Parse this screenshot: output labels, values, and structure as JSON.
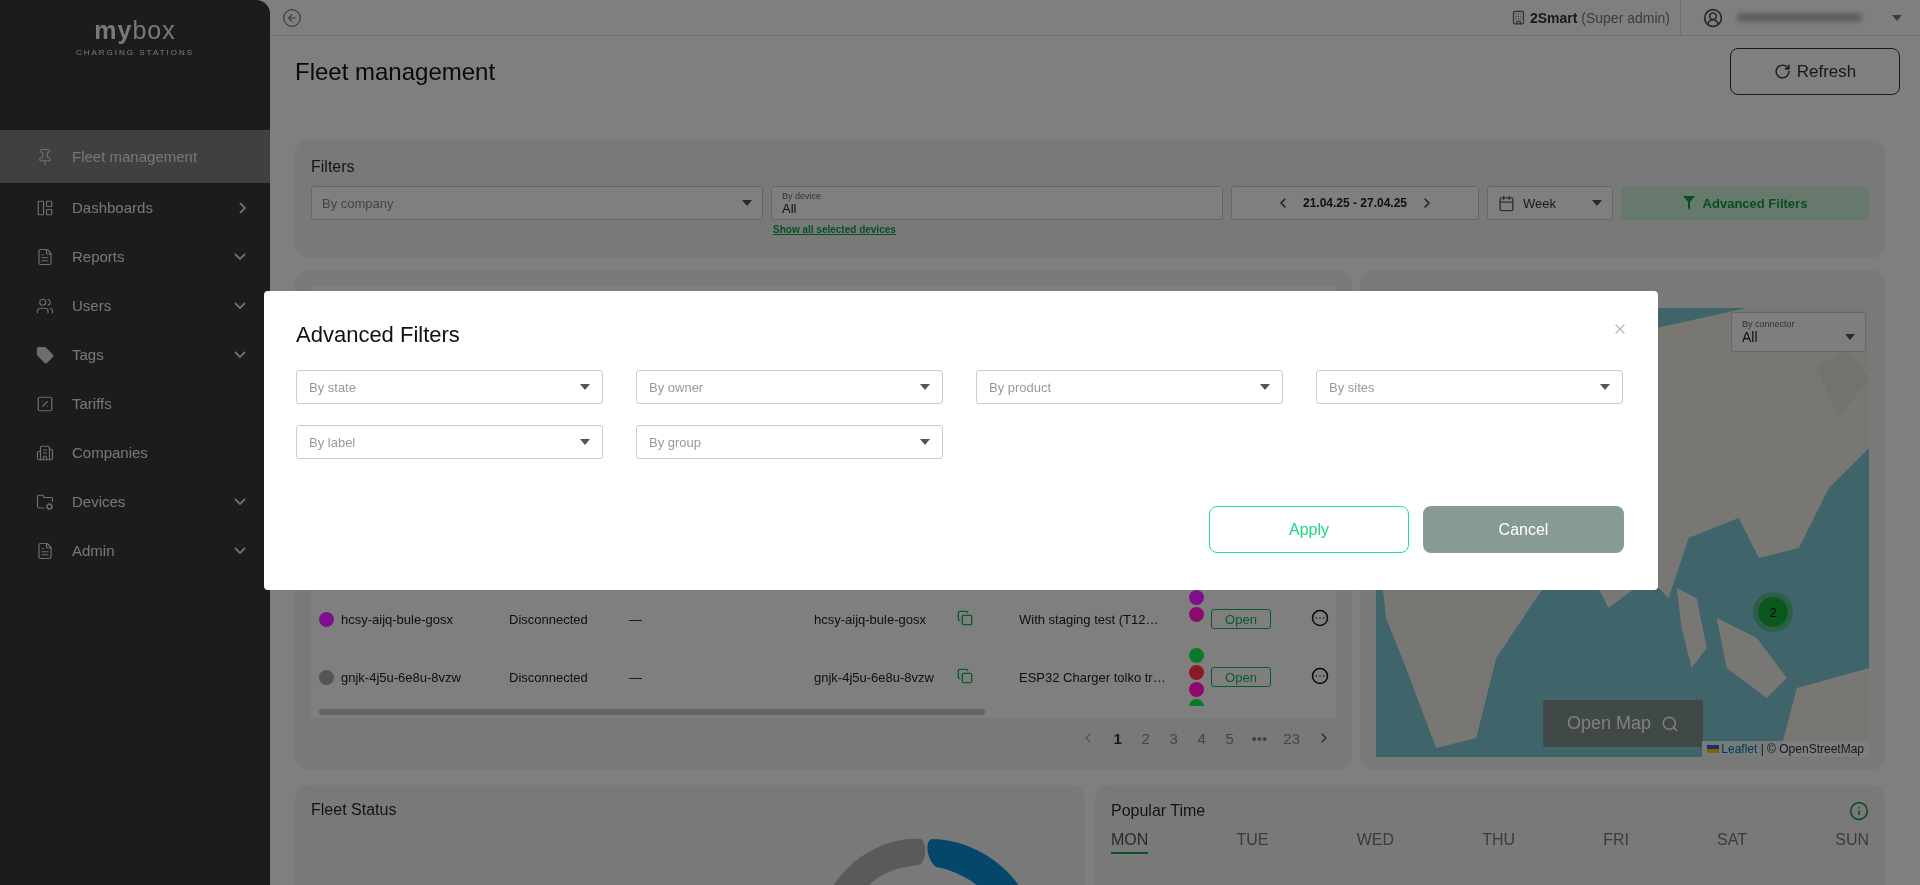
{
  "sidebar": {
    "logo": "**my**box",
    "tagline": "CHARGING STATIONS",
    "items": [
      {
        "label": "Fleet management",
        "kind": "plain",
        "selected": true
      },
      {
        "label": "Dashboards",
        "kind": "flyout",
        "selected": false
      },
      {
        "label": "Reports",
        "kind": "dropdown",
        "selected": false
      },
      {
        "label": "Users",
        "kind": "dropdown",
        "selected": false
      },
      {
        "label": "Tags",
        "kind": "dropdown",
        "selected": false
      },
      {
        "label": "Tariffs",
        "kind": "plain",
        "selected": false
      },
      {
        "label": "Companies",
        "kind": "plain",
        "selected": false
      },
      {
        "label": "Devices",
        "kind": "dropdown",
        "selected": false
      },
      {
        "label": "Admin",
        "kind": "dropdown",
        "selected": false
      }
    ]
  },
  "topbar": {
    "account": "**2Smart** (Super admin)"
  },
  "page": {
    "title": "Fleet management",
    "refresh": "Refresh"
  },
  "filters": {
    "title": "Filters",
    "company": "By company",
    "device": {
      "label": "By device",
      "value": "All",
      "link": "Show all selected devices"
    },
    "date_range": "21.04.25 - 27.04.25",
    "period": "Week",
    "advanced": "Advanced Filters"
  },
  "devices": {
    "rows": [
      {
        "color": "#7e0e8e",
        "id": "hcsy-aijq-bule-gosx",
        "state": "Disconnected",
        "column_3": "—",
        "serial": "hcsy-aijq-bule-gosx",
        "name": "With staging test (T12…",
        "tags": [
          {
            "color": "#7e0e8e"
          },
          {
            "color": "#8c0a6e"
          }
        ],
        "action": "Open"
      },
      {
        "color": "#555555",
        "id": "gnjk-4j5u-6e8u-8vzw",
        "state": "Disconnected",
        "column_3": "—",
        "serial": "gnjk-4j5u-6e8u-8vzw",
        "name": "ESP32 Charger tolko tr…",
        "tags": [
          {
            "color": "#0a7a2a"
          },
          {
            "color": "#8a1a24"
          },
          {
            "color": "#8c0a6e"
          },
          {
            "color": "#0a7a2a"
          }
        ],
        "action": "Open"
      }
    ],
    "pages": [
      {
        "label": "1",
        "selected": true
      },
      {
        "label": "2",
        "selected": false
      },
      {
        "label": "3",
        "selected": false
      },
      {
        "label": "4",
        "selected": false
      },
      {
        "label": "5",
        "selected": false
      },
      {
        "label": "•••",
        "selected": false
      },
      {
        "label": "23",
        "selected": false
      }
    ]
  },
  "map": {
    "connector": {
      "label": "By connector",
      "value": "All"
    },
    "cluster": "2",
    "open": "Open Map",
    "attribution_link": "Leaflet",
    "attribution_text": "| © OpenStreetMap"
  },
  "fleet_status": {
    "title": "Fleet Status"
  },
  "popular_time": {
    "title": "Popular Time",
    "days": [
      {
        "label": "MON",
        "selected": true
      },
      {
        "label": "TUE",
        "selected": false
      },
      {
        "label": "WED",
        "selected": false
      },
      {
        "label": "THU",
        "selected": false
      },
      {
        "label": "FRI",
        "selected": false
      },
      {
        "label": "SAT",
        "selected": false
      },
      {
        "label": "SUN",
        "selected": false
      }
    ]
  },
  "modal": {
    "title": "Advanced Filters",
    "filters": [
      {
        "label": "By state"
      },
      {
        "label": "By owner"
      },
      {
        "label": "By product"
      },
      {
        "label": "By sites"
      },
      {
        "label": "By label"
      },
      {
        "label": "By group"
      }
    ],
    "apply": "Apply",
    "cancel": "Cancel"
  }
}
